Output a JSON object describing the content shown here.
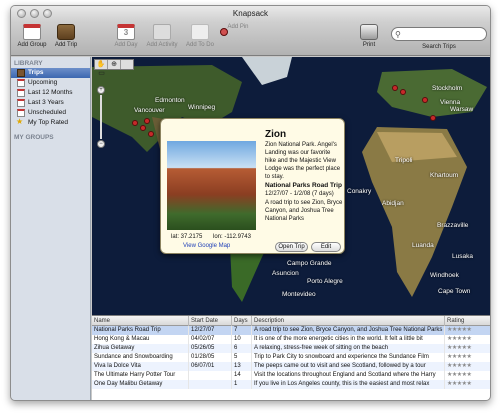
{
  "window": {
    "title": "Knapsack"
  },
  "toolbar": {
    "add_group": "Add Group",
    "add_trip": "Add Trip",
    "add_day": "Add Day",
    "add_activity": "Add Activity",
    "add_todo": "Add To Do",
    "add_pin": "Add Pin",
    "print": "Print",
    "search_label": "Search Trips",
    "search_value": "",
    "calendar_day": "3"
  },
  "sidebar": {
    "library_header": "LIBRARY",
    "items": [
      {
        "label": "Trips",
        "selected": true
      },
      {
        "label": "Upcoming"
      },
      {
        "label": "Last 12 Months"
      },
      {
        "label": "Last 3 Years"
      },
      {
        "label": "Unscheduled"
      },
      {
        "label": "My Top Rated"
      }
    ],
    "groups_header": "MY GROUPS"
  },
  "map": {
    "cities": [
      "Edmonton",
      "Winnipeg",
      "Vancouver",
      "Stockholm",
      "Vienna",
      "Warsaw",
      "Tripoli",
      "Khartoum",
      "Conakry",
      "Luanda",
      "Abidjan",
      "Brazzaville",
      "Lusaka",
      "Windhoek",
      "Cape Town",
      "Campo Grande",
      "Asuncion",
      "Porto Alegre",
      "Montevideo"
    ],
    "tools": [
      "hand",
      "zoom",
      "frame"
    ]
  },
  "popup": {
    "name": "Zion",
    "description": "Zion National Park. Angel's Landing was our favorite hike and the Majestic View Lodge was the perfect place to stay.",
    "trip_name": "National Parks Road Trip",
    "trip_dates": "12/27/07 - 1/2/08 (7 days)",
    "trip_description": "A road trip to see Zion, Bryce Canyon, and Joshua Tree National Parks",
    "lat": "lat: 37.2175",
    "lon": "lon: -112.9743",
    "google_link": "View Google Map",
    "open_trip": "Open Trip",
    "edit": "Edit"
  },
  "table": {
    "columns": [
      "Name",
      "Start Date",
      "Days",
      "Description",
      "Rating"
    ],
    "rows": [
      {
        "name": "National Parks Road Trip",
        "start": "12/27/07",
        "days": "7",
        "desc": "A road trip to see Zion, Bryce Canyon, and Joshua Tree National Parks",
        "rating": 0
      },
      {
        "name": "Hong Kong & Macau",
        "start": "04/02/07",
        "days": "10",
        "desc": "It is one of the more energetic cities in the world. It felt a little bit",
        "rating": 0
      },
      {
        "name": "Zihua Getaway",
        "start": "05/26/05",
        "days": "6",
        "desc": "A relaxing, stress-free week of sitting on the beach",
        "rating": 0
      },
      {
        "name": "Sundance and Snowboarding",
        "start": "01/28/05",
        "days": "5",
        "desc": "Trip to Park City to snowboard and experience the Sundance Film",
        "rating": 0
      },
      {
        "name": "Viva la Dolce Vita",
        "start": "06/07/01",
        "days": "13",
        "desc": "The peeps came out to visit and see Scotland, followed by a tour",
        "rating": 0
      },
      {
        "name": "The Ultimate Harry Potter Tour",
        "start": "",
        "days": "14",
        "desc": "Visit the locations throughout England and Scotland where the Harry",
        "rating": 0
      },
      {
        "name": "One Day Malibu Getaway",
        "start": "",
        "days": "1",
        "desc": "If you live in Los Angeles county, this is the easiest and most relax",
        "rating": 0
      }
    ]
  },
  "colors": {
    "accent": "#3c67b0",
    "pin": "#c62a2a"
  }
}
